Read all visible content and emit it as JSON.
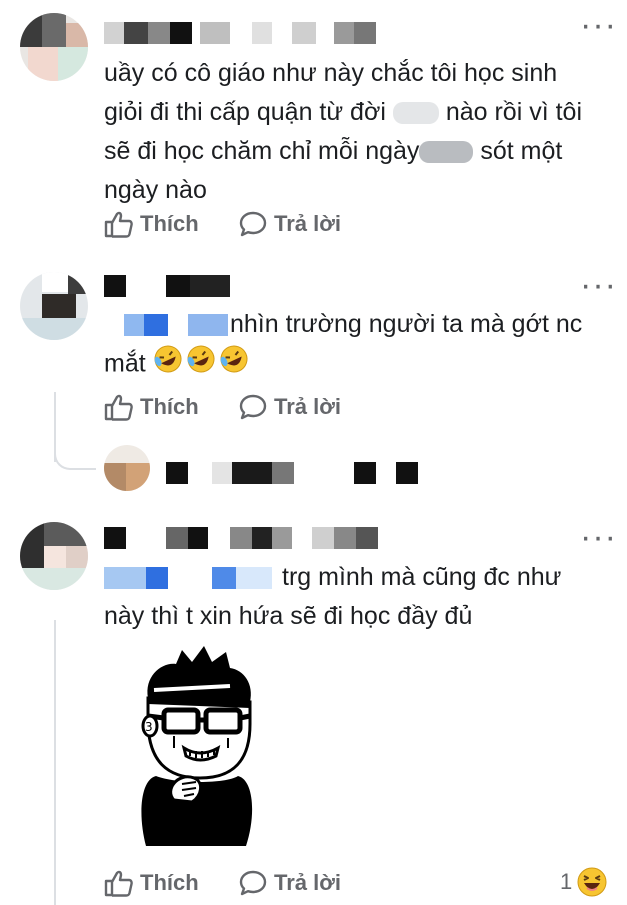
{
  "comments": [
    {
      "text": {
        "line1": "uầy có cô giáo như này chắc tôi học sinh",
        "line2a": "giỏi đi thi cấp quận từ đời",
        "line2b": "nào rồi vì tôi",
        "line3a": "sẽ đi học chăm chỉ mỗi ngày",
        "line3b": "sót một",
        "line4": "ngày nào"
      },
      "like_label": "Thích",
      "reply_label": "Trả lời"
    },
    {
      "text": {
        "line1": "nhìn trường người ta mà gớt nc",
        "line2": "mắt"
      },
      "emoji": "rolling-on-floor-laughing",
      "like_label": "Thích",
      "reply_label": "Trả lời"
    },
    {
      "text": {
        "line1": "trg mình mà cũng đc như",
        "line2": "này thì t xin hứa sẽ đi học đầy đủ"
      },
      "like_label": "Thích",
      "reply_label": "Trả lời",
      "reaction_count": "1",
      "reaction_emoji": "laughing-face"
    }
  ],
  "icons": {
    "more": "more-options-icon",
    "like": "thumbs-up-icon",
    "reply": "speech-bubble-icon"
  },
  "colors": {
    "secondary_text": "#65676b",
    "reaction_yellow": "#f7c531"
  }
}
